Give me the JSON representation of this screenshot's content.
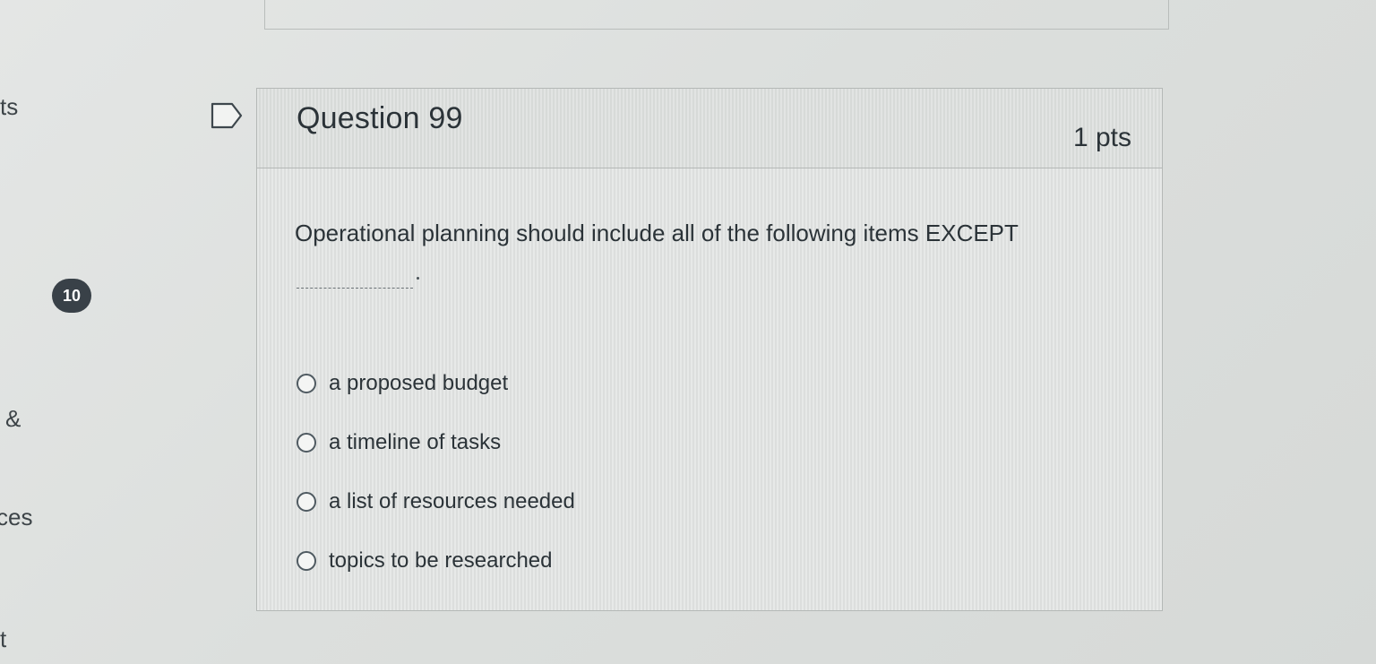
{
  "nav": {
    "fragments": [
      "ts",
      "&",
      "ces",
      "t"
    ],
    "badge": "10"
  },
  "question": {
    "title": "Question 99",
    "points": "1 pts",
    "text": "Operational planning should include all of the following items EXCEPT",
    "answers": [
      "a proposed budget",
      "a timeline of tasks",
      "a list of resources needed",
      "topics to be researched"
    ]
  },
  "colors": {
    "badge": "#394148",
    "text": "#2b3338",
    "border": "#b4b8b6"
  },
  "icons": {
    "flag": "flag-outline-icon",
    "radio": "radio-unselected-icon"
  }
}
